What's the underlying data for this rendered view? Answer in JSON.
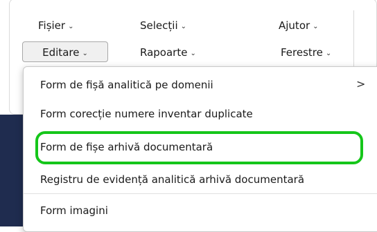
{
  "menubar": {
    "items": [
      {
        "label": "Fișier",
        "chevron": "⌄"
      },
      {
        "label": "Selecții",
        "chevron": "⌄"
      },
      {
        "label": "Ajutor",
        "chevron": "⌄"
      },
      {
        "label": "Editare",
        "chevron": "⌄"
      },
      {
        "label": "Rapoarte",
        "chevron": "⌄"
      },
      {
        "label": "Ferestre",
        "chevron": "⌄"
      }
    ],
    "active": "Editare"
  },
  "dropdown": {
    "items": [
      {
        "label": "Form de fișă analitică pe domenii",
        "submenu": true,
        "submenu_glyph": ">"
      },
      {
        "label": "Form corecție numere inventar duplicate"
      },
      {
        "label": "Form de fișe arhivă documentară",
        "highlighted": true
      },
      {
        "label": "Registru de evidență analitică arhivă documentară"
      },
      {
        "label": "Form imagini"
      }
    ]
  },
  "colors": {
    "highlight": "#15c61a",
    "background_band": "#1f2c4f",
    "active_button_bg": "#f0f0f0"
  }
}
